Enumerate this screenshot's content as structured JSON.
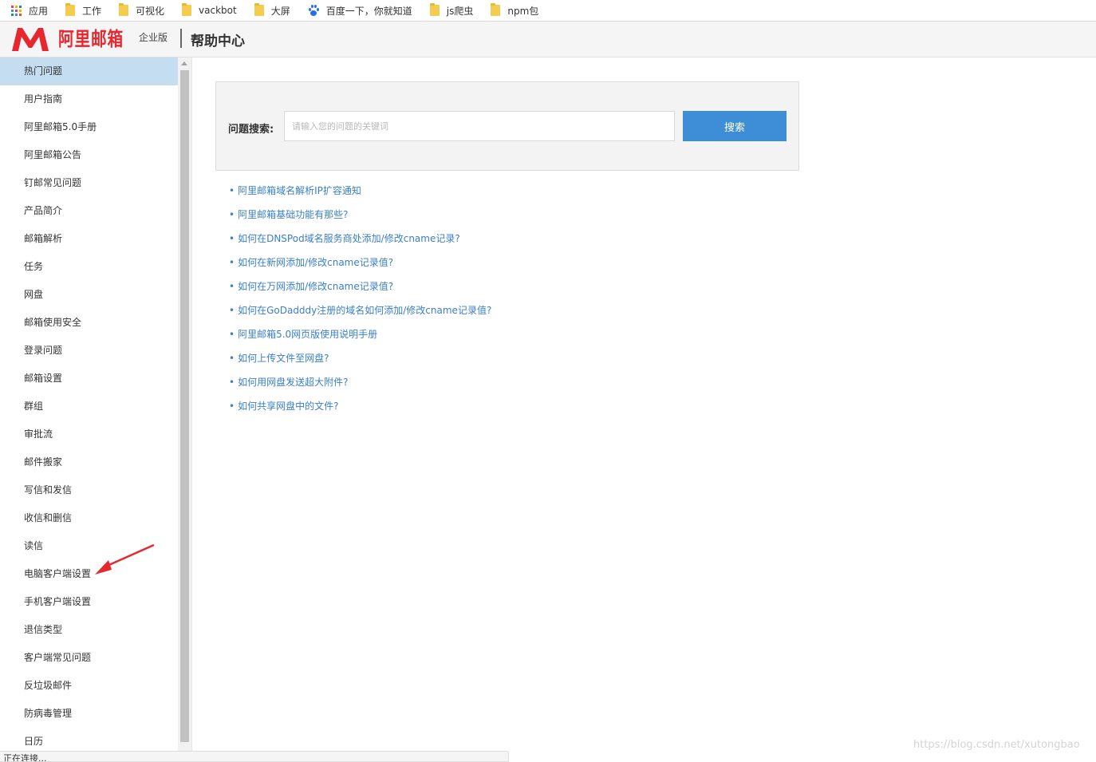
{
  "bookmarks": [
    {
      "label": "应用",
      "icon": "apps-icon"
    },
    {
      "label": "工作",
      "icon": "folder-icon"
    },
    {
      "label": "可视化",
      "icon": "folder-icon"
    },
    {
      "label": "vackbot",
      "icon": "folder-icon"
    },
    {
      "label": "大屏",
      "icon": "folder-icon"
    },
    {
      "label": "百度一下，你就知道",
      "icon": "baidu-paw-icon"
    },
    {
      "label": "js爬虫",
      "icon": "folder-icon"
    },
    {
      "label": "npm包",
      "icon": "folder-icon"
    }
  ],
  "header": {
    "logo_text": "阿里邮箱",
    "edition": "企业版",
    "title": "帮助中心",
    "brand_color": "#e8262e"
  },
  "sidebar": {
    "active_index": 0,
    "items": [
      "热门问题",
      "用户指南",
      "阿里邮箱5.0手册",
      "阿里邮箱公告",
      "钉邮常见问题",
      "产品简介",
      "邮箱解析",
      "任务",
      "网盘",
      "邮箱使用安全",
      "登录问题",
      "邮箱设置",
      "群组",
      "审批流",
      "邮件搬家",
      "写信和发信",
      "收信和删信",
      "读信",
      "电脑客户端设置",
      "手机客户端设置",
      "退信类型",
      "客户端常见问题",
      "反垃圾邮件",
      "防病毒管理",
      "日历"
    ]
  },
  "search": {
    "label": "问题搜索:",
    "placeholder": "请输入您的问题的关键词",
    "value": "",
    "button_label": "搜索",
    "button_color": "#3d8ed6"
  },
  "faq": {
    "bullet": "•",
    "link_color": "#3a7fc6",
    "items": [
      "阿里邮箱域名解析IP扩容通知",
      "阿里邮箱基础功能有那些?",
      "如何在DNSPod域名服务商处添加/修改cname记录?",
      "如何在新网添加/修改cname记录值?",
      "如何在万网添加/修改cname记录值?",
      "如何在GoDadddy注册的域名如何添加/修改cname记录值?",
      "阿里邮箱5.0网页版使用说明手册",
      "如何上传文件至网盘?",
      "如何用网盘发送超大附件?",
      "如何共享网盘中的文件?"
    ]
  },
  "annotation": {
    "icon": "red-arrow-icon",
    "color": "#e8262e"
  },
  "status_text": "正在连接...",
  "watermark": "https://blog.csdn.net/xutongbao"
}
